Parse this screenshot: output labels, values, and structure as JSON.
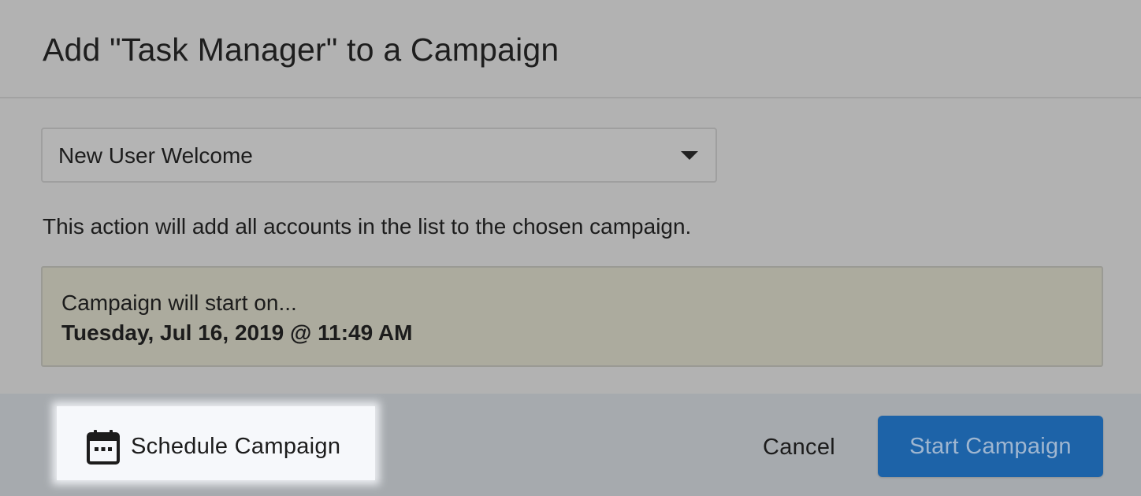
{
  "dialog": {
    "title": "Add \"Task Manager\" to a Campaign"
  },
  "campaign_select": {
    "selected": "New User Welcome"
  },
  "description": "This action will add all accounts in the list to the chosen campaign.",
  "start_info": {
    "label": "Campaign will start on...",
    "datetime": "Tuesday, Jul 16, 2019 @ 11:49 AM"
  },
  "footer": {
    "schedule_label": "Schedule Campaign",
    "schedule_icon": "calendar-icon",
    "cancel_label": "Cancel",
    "start_label": "Start Campaign"
  },
  "colors": {
    "modal_bg": "#b2b2b2",
    "info_box_bg": "#acab9e",
    "footer_bg": "#a6aaae",
    "primary_button": "#1d63a8",
    "highlight": "#f6f8fb"
  }
}
